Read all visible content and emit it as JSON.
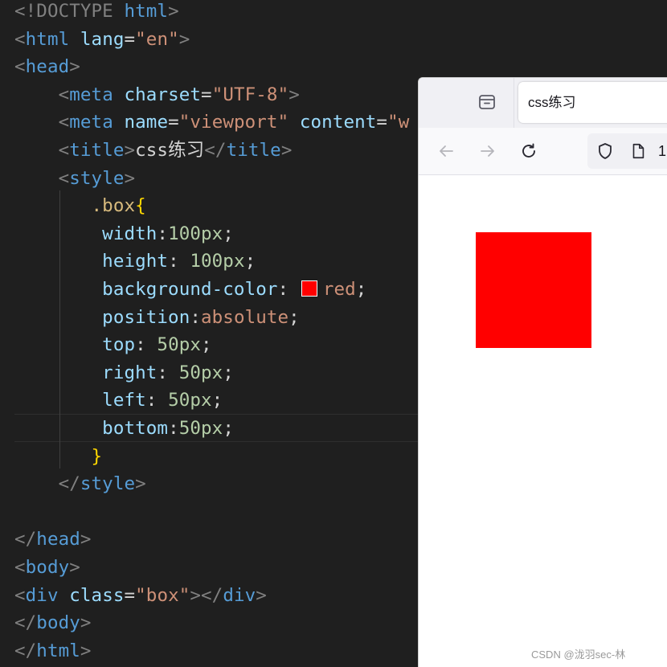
{
  "editor": {
    "lines": [
      {
        "parts": [
          [
            "t",
            "<"
          ],
          [
            "g",
            "!DOCTYPE "
          ],
          [
            "tag",
            "html"
          ],
          [
            "t",
            ">"
          ]
        ]
      },
      {
        "parts": [
          [
            "t",
            "<"
          ],
          [
            "tag",
            "html"
          ],
          [
            "plain",
            " "
          ],
          [
            "attr",
            "lang"
          ],
          [
            "plain",
            "="
          ],
          [
            "str",
            "\"en\""
          ],
          [
            "t",
            ">"
          ]
        ]
      },
      {
        "parts": [
          [
            "t",
            "<"
          ],
          [
            "tag",
            "head"
          ],
          [
            "t",
            ">"
          ]
        ]
      },
      {
        "parts": [
          [
            "plain",
            "    "
          ],
          [
            "t",
            "<"
          ],
          [
            "tag",
            "meta"
          ],
          [
            "plain",
            " "
          ],
          [
            "attr",
            "charset"
          ],
          [
            "plain",
            "="
          ],
          [
            "str",
            "\"UTF-8\""
          ],
          [
            "t",
            ">"
          ]
        ]
      },
      {
        "parts": [
          [
            "plain",
            "    "
          ],
          [
            "t",
            "<"
          ],
          [
            "tag",
            "meta"
          ],
          [
            "plain",
            " "
          ],
          [
            "attr",
            "name"
          ],
          [
            "plain",
            "="
          ],
          [
            "str",
            "\"viewport\""
          ],
          [
            "plain",
            " "
          ],
          [
            "attr",
            "content"
          ],
          [
            "plain",
            "="
          ],
          [
            "str",
            "\"w"
          ]
        ]
      },
      {
        "parts": [
          [
            "plain",
            "    "
          ],
          [
            "t",
            "<"
          ],
          [
            "tag",
            "title"
          ],
          [
            "t",
            ">"
          ],
          [
            "txt",
            "css练习"
          ],
          [
            "t",
            "</"
          ],
          [
            "tag",
            "title"
          ],
          [
            "t",
            ">"
          ]
        ]
      },
      {
        "parts": [
          [
            "plain",
            "    "
          ],
          [
            "t",
            "<"
          ],
          [
            "tag",
            "style"
          ],
          [
            "t",
            ">"
          ]
        ]
      },
      {
        "parts": [
          [
            "plain",
            "       "
          ],
          [
            "sel",
            ".box"
          ],
          [
            "brace",
            "{"
          ]
        ]
      },
      {
        "parts": [
          [
            "plain",
            "        "
          ],
          [
            "prop",
            "width"
          ],
          [
            "plain",
            ":"
          ],
          [
            "num",
            "100px"
          ],
          [
            "plain",
            ";"
          ]
        ]
      },
      {
        "parts": [
          [
            "plain",
            "        "
          ],
          [
            "prop",
            "height"
          ],
          [
            "plain",
            ": "
          ],
          [
            "num",
            "100px"
          ],
          [
            "plain",
            ";"
          ]
        ]
      },
      {
        "parts": [
          [
            "plain",
            "        "
          ],
          [
            "prop",
            "background-color"
          ],
          [
            "plain",
            ": "
          ],
          [
            "swatch",
            ""
          ],
          [
            "val",
            "red"
          ],
          [
            "plain",
            ";"
          ]
        ]
      },
      {
        "parts": [
          [
            "plain",
            "        "
          ],
          [
            "prop",
            "position"
          ],
          [
            "plain",
            ":"
          ],
          [
            "val",
            "absolute"
          ],
          [
            "plain",
            ";"
          ]
        ]
      },
      {
        "parts": [
          [
            "plain",
            "        "
          ],
          [
            "prop",
            "top"
          ],
          [
            "plain",
            ": "
          ],
          [
            "num",
            "50px"
          ],
          [
            "plain",
            ";"
          ]
        ]
      },
      {
        "parts": [
          [
            "plain",
            "        "
          ],
          [
            "prop",
            "right"
          ],
          [
            "plain",
            ": "
          ],
          [
            "num",
            "50px"
          ],
          [
            "plain",
            ";"
          ]
        ]
      },
      {
        "parts": [
          [
            "plain",
            "        "
          ],
          [
            "prop",
            "left"
          ],
          [
            "plain",
            ": "
          ],
          [
            "num",
            "50px"
          ],
          [
            "plain",
            ";"
          ]
        ]
      },
      {
        "parts": [
          [
            "plain",
            "        "
          ],
          [
            "prop",
            "bottom"
          ],
          [
            "plain",
            ":"
          ],
          [
            "num",
            "50px"
          ],
          [
            "plain",
            ";"
          ]
        ]
      },
      {
        "parts": [
          [
            "plain",
            "       "
          ],
          [
            "brace",
            "}"
          ]
        ]
      },
      {
        "parts": [
          [
            "plain",
            "    "
          ],
          [
            "t",
            "</"
          ],
          [
            "tag",
            "style"
          ],
          [
            "t",
            ">"
          ]
        ]
      },
      {
        "parts": []
      },
      {
        "parts": [
          [
            "t",
            "</"
          ],
          [
            "tag",
            "head"
          ],
          [
            "t",
            ">"
          ]
        ]
      },
      {
        "parts": [
          [
            "t",
            "<"
          ],
          [
            "tag",
            "body"
          ],
          [
            "t",
            ">"
          ]
        ]
      },
      {
        "parts": [
          [
            "t",
            "<"
          ],
          [
            "tag",
            "div"
          ],
          [
            "plain",
            " "
          ],
          [
            "attr",
            "class"
          ],
          [
            "plain",
            "="
          ],
          [
            "str",
            "\"box\""
          ],
          [
            "t",
            "></"
          ],
          [
            "tag",
            "div"
          ],
          [
            "t",
            ">"
          ]
        ]
      },
      {
        "parts": [
          [
            "t",
            "</"
          ],
          [
            "tag",
            "body"
          ],
          [
            "t",
            ">"
          ]
        ]
      },
      {
        "parts": [
          [
            "t",
            "</"
          ],
          [
            "tag",
            "html"
          ],
          [
            "t",
            ">"
          ]
        ]
      }
    ]
  },
  "browser": {
    "tab_title": "css练习",
    "url_text": "1",
    "tab_list_icon": "tab-list-icon",
    "nav_icons": [
      "back-arrow-icon",
      "forward-arrow-icon",
      "reload-icon",
      "shield-icon",
      "page-icon"
    ],
    "box_color": "#ff0000"
  },
  "watermark": "CSDN @泷羽sec-林"
}
